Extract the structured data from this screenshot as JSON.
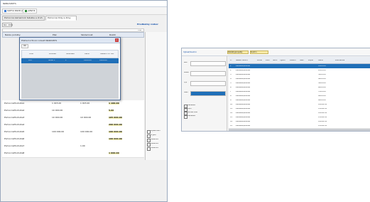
{
  "left_window": {
    "title": "NAKOUNYS",
    "toolbar": {
      "project_btn": "Sumu ducti projekt",
      "exit_btn": "Zavřít"
    },
    "tabs": [
      "Pomocné záznamník tabulka a druhů prací",
      "Pomocné třídy a dílny"
    ],
    "filter": {
      "year": "Rok: 2011",
      "label": "Předběžný rozbor",
      "stav": "Stav",
      "tisk": "Tisk"
    },
    "grid_columns": [
      "Název položky",
      "Plán",
      "Skutečnost",
      "Rozdíl",
      "%"
    ],
    "rows": [
      {
        "name": "PomocnáHodnota1",
        "a": "1 015.00",
        "b": "1 015.00",
        "c": "1 100.00"
      },
      {
        "name": "PomocnáHodnota2",
        "a": "10 000.00",
        "b": "",
        "c": "5.00"
      },
      {
        "name": "PomocnáHodnota3",
        "a": "10 000.00",
        "b": "10 000.00",
        "c": "105 000.00"
      },
      {
        "name": "PomocnáHodnota4",
        "a": "",
        "b": "",
        "c": "200 000.00"
      },
      {
        "name": "PomocnáHodnota5",
        "a": "100 000.00",
        "b": "100 000.00",
        "c": "100 000.00"
      },
      {
        "name": "PomocnáHodnota6",
        "a": "",
        "b": "",
        "c": "100 000.00"
      },
      {
        "name": "PomocnáHodnota7",
        "a": "",
        "b": "1.00",
        "c": ""
      },
      {
        "name": "PomocnáHodnota8",
        "a": "",
        "b": "",
        "c": "1 000.00"
      }
    ],
    "right_checks": [
      "Opakování",
      "Příjem",
      "Uzavření",
      "Uzavření",
      "Uzavření"
    ],
    "dialog": {
      "title": "Přehled účtů pro projekt NAKOUNYS",
      "toolbar_btn": "OK",
      "columns": [
        "Účet",
        "Položka",
        "Středisko",
        "Cena",
        "Celkem cz. DPH"
      ],
      "selected_row": [
        "103",
        "Sklad 1",
        "1",
        "1000.00",
        "1000.00"
      ]
    }
  },
  "right_window": {
    "title": "Výkaz/Souhrn",
    "tabs": [
      "Zakázky/projekty",
      "Souhrn"
    ],
    "columns": [
      "Č.",
      "Název úkonu",
      "Počet",
      "Plán",
      "Skut.",
      "Výkon",
      "Datum",
      "Stav",
      "Popis",
      "Cena",
      "Poznámka"
    ],
    "rows": [
      {
        "no": "1",
        "name": "Zakázka/služba",
        "cena": "1000.00"
      },
      {
        "no": "2",
        "name": "Zakázka/služba",
        "cena": "2000.00"
      },
      {
        "no": "3",
        "name": "Zakázka/služba",
        "cena": "3000.00"
      },
      {
        "no": "4",
        "name": "Zakázka/služba",
        "cena": "4000.00"
      },
      {
        "no": "5",
        "name": "Zakázka/služba",
        "cena": "5000.00"
      },
      {
        "no": "6",
        "name": "Zakázka/služba",
        "cena": "6000.00"
      },
      {
        "no": "7",
        "name": "Zakázka/služba",
        "cena": "7000.00"
      },
      {
        "no": "8",
        "name": "Zakázka/služba",
        "cena": "8000.00"
      },
      {
        "no": "9",
        "name": "Zakázka/služba",
        "cena": "9000.00"
      },
      {
        "no": "10",
        "name": "Zakázka/služba",
        "cena": "10000.00"
      },
      {
        "no": "11",
        "name": "Zakázka/služba",
        "cena": "11000.00"
      },
      {
        "no": "12",
        "name": "Zakázka/služba",
        "cena": "12000.00"
      },
      {
        "no": "13",
        "name": "Zakázka/služba",
        "cena": "13000.00"
      },
      {
        "no": "14",
        "name": "Zakázka/služba",
        "cena": "14000.00"
      },
      {
        "no": "15",
        "name": "Zakázka/služba",
        "cena": "15000.00"
      }
    ],
    "filters": [
      "Rok",
      "Měsíc",
      "Typ",
      "Stav"
    ],
    "left_checks": [
      "Zakázka",
      "Plán",
      "Skutečnost",
      "Zakázka"
    ],
    "accent": "#1f6fb8"
  }
}
